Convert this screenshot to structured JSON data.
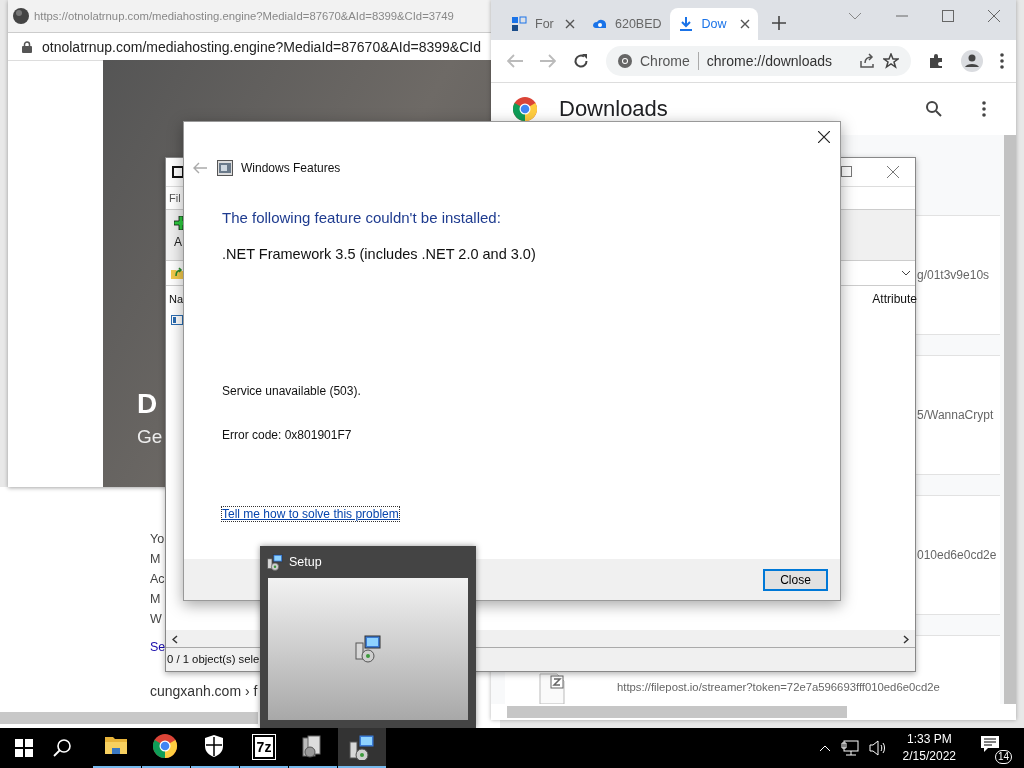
{
  "background_browser": {
    "title_url": "https://otnolatrnup.com/mediahosting.engine?MediaId=87670&AId=8399&CId=3749",
    "address": "otnolatrnup.com/mediahosting.engine?MediaId=87670&AId=8399&CId",
    "hero_title": "D",
    "hero_subtitle": "Ge"
  },
  "search_page": {
    "lines": [
      "Yo",
      "M",
      "Ac",
      "M",
      "W"
    ],
    "link": "Se",
    "breadcrumb": "cungxanh.com › f"
  },
  "chrome": {
    "tabs": [
      {
        "label": "For",
        "kind": "grid",
        "selected": false,
        "close_button": true
      },
      {
        "label": "620BED",
        "kind": "cloud",
        "selected": false,
        "close_button": false
      },
      {
        "label": "Dow",
        "kind": "download",
        "selected": true,
        "close_button": true
      }
    ],
    "site_chip": "Chrome",
    "address": "chrome://downloads",
    "page_title": "Downloads",
    "items": [
      {
        "text": "g/01t3v9e10s",
        "file_icon": false
      },
      {
        "text": "5/WannaCrypt",
        "file_icon": false
      },
      {
        "text": "010ed6e0cd2e",
        "file_icon": false
      },
      {
        "text": "https://filepost.io/streamer?token=72e7a596693fff010ed6e0cd2e",
        "file_icon": true
      }
    ]
  },
  "sevenzip": {
    "menu": "Fil",
    "toolbar_label": "A",
    "column_name": "Na",
    "column_attributes": "Attribute",
    "status": "0 / 1 object(s) sele"
  },
  "dialog": {
    "title": "Windows Features",
    "heading": "The following feature couldn't be installed:",
    "feature": ".NET Framework 3.5 (includes .NET 2.0 and 3.0)",
    "message": "Service unavailable (503).",
    "error": "Error code: 0x801901F7",
    "link": "Tell me how to solve this problem",
    "button": "Close"
  },
  "setup": {
    "title": "Setup"
  },
  "taskbar": {
    "apps": [
      {
        "kind": "folder",
        "running": true,
        "selected": false
      },
      {
        "kind": "chrome",
        "running": true,
        "selected": false
      },
      {
        "kind": "shield",
        "running": true,
        "selected": false
      },
      {
        "kind": "sevenzip",
        "logo": "7z",
        "running": true,
        "selected": false
      },
      {
        "kind": "installer",
        "running": true,
        "selected": false
      },
      {
        "kind": "setup",
        "running": true,
        "selected": true
      }
    ],
    "time": "1:33 PM",
    "date": "2/15/2022",
    "notifications": "14"
  }
}
